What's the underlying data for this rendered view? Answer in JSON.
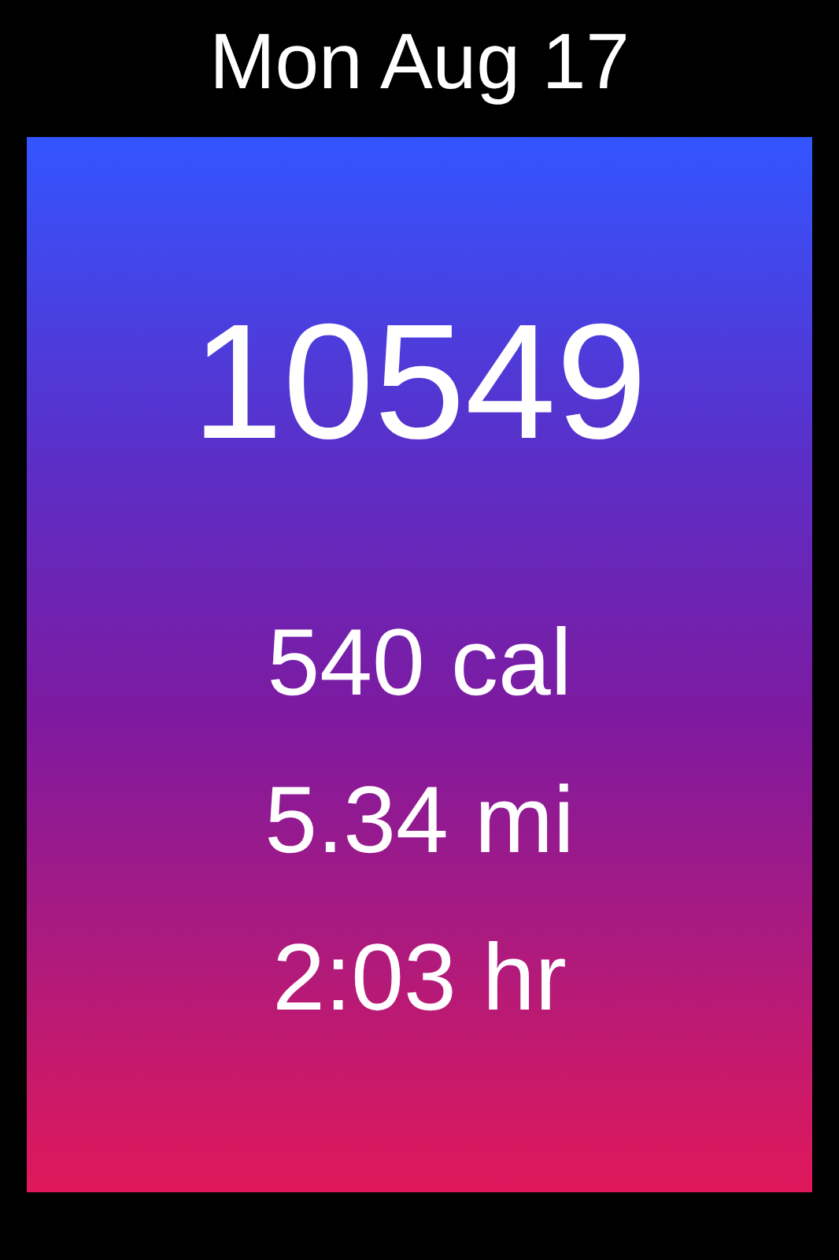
{
  "date": "Mon Aug 17",
  "steps": "10549",
  "stats": [
    "540 cal",
    "5.34 mi",
    "2:03 hr"
  ]
}
